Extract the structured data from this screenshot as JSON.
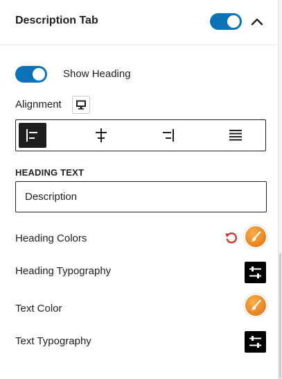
{
  "panel": {
    "title": "Description Tab",
    "enabled": true
  },
  "show_heading": {
    "label": "Show Heading",
    "enabled": true
  },
  "alignment": {
    "label": "Alignment",
    "device_icon": "desktop-icon",
    "options": [
      "align-left",
      "align-center",
      "align-right",
      "align-justify"
    ],
    "selected": "align-left"
  },
  "heading_text": {
    "label": "HEADING TEXT",
    "value": "Description"
  },
  "rows": {
    "heading_colors": "Heading Colors",
    "heading_typography": "Heading Typography",
    "text_color": "Text Color",
    "text_typography": "Text Typography"
  },
  "colors": {
    "accent": "#0a73b8",
    "swatch": "#eb8a28",
    "reset": "#d6312c"
  }
}
